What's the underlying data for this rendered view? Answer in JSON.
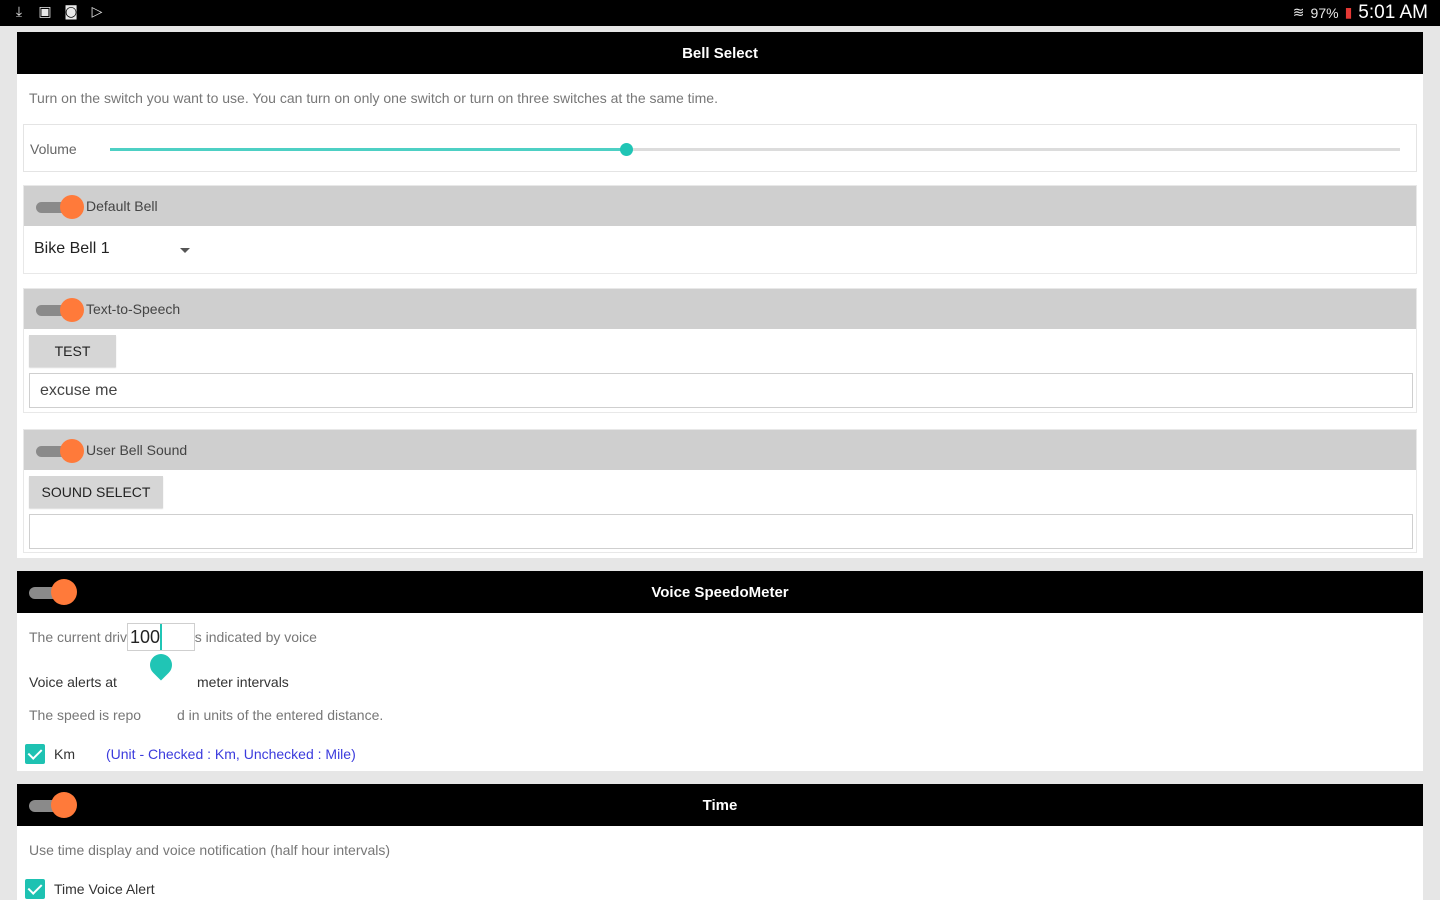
{
  "status_bar": {
    "icons_left": [
      "download-icon",
      "image-icon",
      "screenshot-icon",
      "play-store-icon"
    ],
    "battery": "97%",
    "time": "5:01 AM"
  },
  "bell_select": {
    "title": "Bell Select",
    "description": "Turn on the switch you want to use. You can turn on only one switch or turn on three switches at the same time.",
    "volume": {
      "label": "Volume",
      "value_fraction": 0.4
    },
    "default_bell": {
      "title": "Default Bell",
      "selected": "Bike Bell 1"
    },
    "tts": {
      "title": "Text-to-Speech",
      "test_button": "TEST",
      "input_value": "excuse me"
    },
    "user_bell": {
      "title": "User Bell Sound",
      "select_button": "SOUND SELECT",
      "input_value": ""
    }
  },
  "voice_speedometer": {
    "title": "Voice SpeedoMeter",
    "description": "The current driving speed is indicated by voice",
    "alerts_prefix": "Voice alerts at",
    "interval_value": "100",
    "alerts_suffix": "meter intervals",
    "note_before": "The speed is repo",
    "note_after": "d in units of the entered distance.",
    "km_label": "Km",
    "unit_hint": "(Unit - Checked : Km, Unchecked : Mile)"
  },
  "time": {
    "title": "Time",
    "description": "Use time display and voice notification (half hour intervals)",
    "voice_alert_label": "Time Voice Alert"
  },
  "colors": {
    "accent_teal": "#20c5b5",
    "switch_orange": "#ff7a3a",
    "header_black": "#000000",
    "hint_blue": "#3b3bdd"
  }
}
